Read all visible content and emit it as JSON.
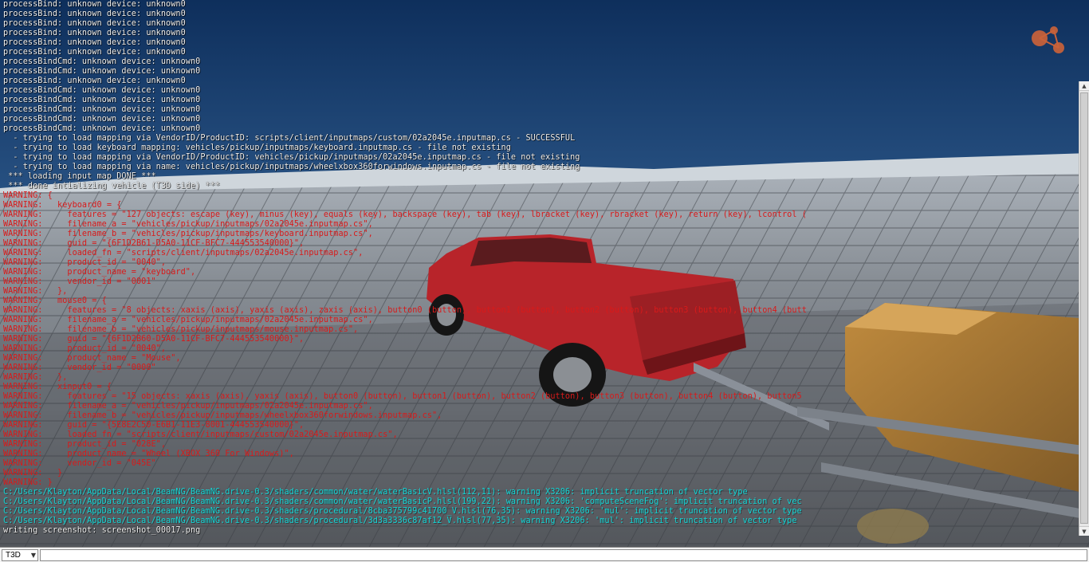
{
  "console": {
    "lines": [
      {
        "text": "processBind: unknown device: unknown0",
        "color": "white"
      },
      {
        "text": "processBind: unknown device: unknown0",
        "color": "white"
      },
      {
        "text": "processBind: unknown device: unknown0",
        "color": "white"
      },
      {
        "text": "processBind: unknown device: unknown0",
        "color": "white"
      },
      {
        "text": "processBind: unknown device: unknown0",
        "color": "white"
      },
      {
        "text": "processBind: unknown device: unknown0",
        "color": "white"
      },
      {
        "text": "processBindCmd: unknown device: unknown0",
        "color": "white"
      },
      {
        "text": "processBindCmd: unknown device: unknown0",
        "color": "white"
      },
      {
        "text": "processBind: unknown device: unknown0",
        "color": "white"
      },
      {
        "text": "processBindCmd: unknown device: unknown0",
        "color": "white"
      },
      {
        "text": "processBindCmd: unknown device: unknown0",
        "color": "white"
      },
      {
        "text": "processBindCmd: unknown device: unknown0",
        "color": "white"
      },
      {
        "text": "processBindCmd: unknown device: unknown0",
        "color": "white"
      },
      {
        "text": "processBindCmd: unknown device: unknown0",
        "color": "white"
      },
      {
        "text": "  - trying to load mapping via VendorID/ProductID: scripts/client/inputmaps/custom/02a2045e.inputmap.cs - SUCCESSFUL",
        "color": "white"
      },
      {
        "text": "  - trying to load keyboard mapping: vehicles/pickup/inputmaps/keyboard.inputmap.cs - file not existing",
        "color": "white"
      },
      {
        "text": "  - trying to load mapping via VendorID/ProductID: vehicles/pickup/inputmaps/02a2045e.inputmap.cs - file not existing",
        "color": "white"
      },
      {
        "text": "  - trying to load mapping via name: vehicles/pickup/inputmaps/wheelxbox360forwindows.inputmap.cs - file not existing",
        "color": "white"
      },
      {
        "text": " *** loading input map DONE ***",
        "color": "white"
      },
      {
        "text": " *** done intializing vehicle (T3D side) ***",
        "color": "white"
      },
      {
        "text": "WARNING: {",
        "color": "red"
      },
      {
        "text": "WARNING:   keyboard0 = {",
        "color": "red"
      },
      {
        "text": "WARNING:     features = \"127 objects: escape (key), minus (key), equals (key), backspace (key), tab (key), lbracket (key), rbracket (key), return (key), lcontrol (",
        "color": "red"
      },
      {
        "text": "WARNING:     filename_a = \"vehicles/pickup/inputmaps/02a2045e.inputmap.cs\",",
        "color": "red"
      },
      {
        "text": "WARNING:     filename_b = \"vehicles/pickup/inputmaps/keyboard.inputmap.cs\",",
        "color": "red"
      },
      {
        "text": "WARNING:     guid = \"{6F1D2B61-D5A0-11CF-BFC7-444553540000}\",",
        "color": "red"
      },
      {
        "text": "WARNING:     loaded_fn = \"scripts/client/inputmaps/02a2045e.inputmap.cs\",",
        "color": "red"
      },
      {
        "text": "WARNING:     product_id = \"0040\",",
        "color": "red"
      },
      {
        "text": "WARNING:     product_name = \"keyboard\",",
        "color": "red"
      },
      {
        "text": "WARNING:     vendor_id = \"0001\"",
        "color": "red"
      },
      {
        "text": "WARNING:   },",
        "color": "red"
      },
      {
        "text": "WARNING:   mouse0 = {",
        "color": "red"
      },
      {
        "text": "WARNING:     features = \"8 objects: xaxis (axis), yaxis (axis), zaxis (axis), button0 (button), button1 (button), button2 (button), button3 (button), button4 (butt",
        "color": "red"
      },
      {
        "text": "WARNING:     filename_a = \"vehicles/pickup/inputmaps/02a2045e.inputmap.cs\",",
        "color": "red"
      },
      {
        "text": "WARNING:     filename_b = \"vehicles/pickup/inputmaps/mouse.inputmap.cs\",",
        "color": "red"
      },
      {
        "text": "WARNING:     guid = \"{6F1D2B60-D5A0-11CF-BFC7-444553540000}\",",
        "color": "red"
      },
      {
        "text": "WARNING:     product_id = \"0040\",",
        "color": "red"
      },
      {
        "text": "WARNING:     product_name = \"Mouse\",",
        "color": "red"
      },
      {
        "text": "WARNING:     vendor_id = \"0000\"",
        "color": "red"
      },
      {
        "text": "WARNING:   },",
        "color": "red"
      },
      {
        "text": "WARNING:   xinput0 = {",
        "color": "red"
      },
      {
        "text": "WARNING:     features = \"15 objects: xaxis (axis), yaxis (axis), button0 (button), button1 (button), button2 (button), button3 (button), button4 (button), button5",
        "color": "red"
      },
      {
        "text": "WARNING:     filename_a = \"vehicles/pickup/inputmaps/02a2045e.inputmap.cs\",",
        "color": "red"
      },
      {
        "text": "WARNING:     filename_b = \"vehicles/pickup/inputmaps/wheelxbox360forwindows.inputmap.cs\",",
        "color": "red"
      },
      {
        "text": "WARNING:     guid = \"{5E8E2C50-E6B1-11E3-8001-444553540000}\",",
        "color": "red"
      },
      {
        "text": "WARNING:     loaded_fn = \"scripts/client/inputmaps/custom/02a2045e.inputmap.cs\",",
        "color": "red"
      },
      {
        "text": "WARNING:     product_id = \"028E\",",
        "color": "red"
      },
      {
        "text": "WARNING:     product_name = \"Wheel (XBOX 360 For Windows)\",",
        "color": "red"
      },
      {
        "text": "WARNING:     vendor_id = \"045E\"",
        "color": "red"
      },
      {
        "text": "WARNING:   }",
        "color": "red"
      },
      {
        "text": "WARNING: }",
        "color": "red"
      },
      {
        "text": "C:/Users/Klayton/AppData/Local/BeamNG/BeamNG.drive-0.3/shaders/common/water/waterBasicV.hlsl(112,11): warning X3206: implicit truncation of vector type",
        "color": "cyan"
      },
      {
        "text": "C:/Users/Klayton/AppData/Local/BeamNG/BeamNG.drive-0.3/shaders/common/water/waterBasicP.hlsl(199,22): warning X3206: 'computeSceneFog': implicit truncation of vec",
        "color": "cyan"
      },
      {
        "text": "C:/Users/Klayton/AppData/Local/BeamNG/BeamNG.drive-0.3/shaders/procedural/8cba375799c41700_V.hlsl(76,35): warning X3206: 'mul': implicit truncation of vector type",
        "color": "cyan"
      },
      {
        "text": "C:/Users/Klayton/AppData/Local/BeamNG/BeamNG.drive-0.3/shaders/procedural/3d3a3336c87af12_V.hlsl(77,35): warning X3206: 'mul': implicit truncation of vector type",
        "color": "cyan"
      },
      {
        "text": "writing screenshot: screenshot_00017.png",
        "color": "white"
      }
    ]
  },
  "bottom_bar": {
    "mode_label": "T3D",
    "command_value": "",
    "command_placeholder": ""
  },
  "icons": {
    "logo": "beamng-logo-icon",
    "mode_dropdown": "chevron-down-icon",
    "scroll_up": "scroll-up-arrow-icon",
    "scroll_down": "scroll-down-arrow-icon"
  },
  "colors": {
    "log_white": "#f2f2f2",
    "log_red": "#d81a1a",
    "log_cyan": "#12d6d6",
    "logo_orange": "#c9623a",
    "truck_red": "#b8242a"
  }
}
